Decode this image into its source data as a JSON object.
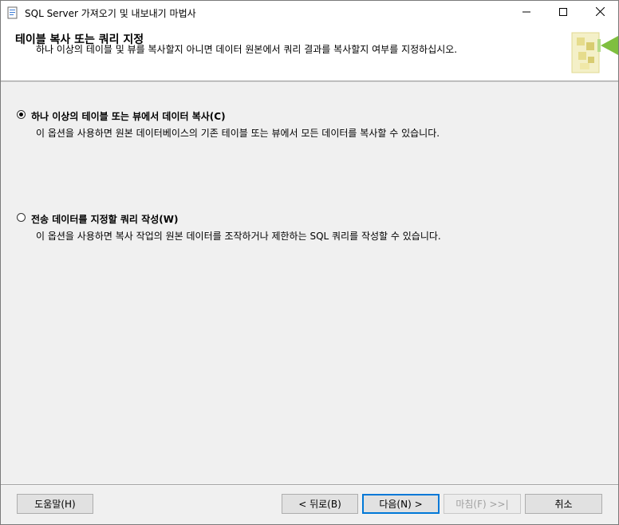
{
  "window": {
    "title": "SQL Server 가져오기 및 내보내기 마법사",
    "icons": [
      "app-icon",
      "minimize-icon",
      "maximize-icon",
      "close-icon"
    ]
  },
  "header": {
    "title": "테이블 복사 또는 쿼리 지정",
    "description": "하나 이상의 테이블 및 뷰를 복사할지 아니면 데이터 원본에서 쿼리 결과를 복사할지 여부를 지정하십시오.",
    "graphic": "wizard-graphic-icon"
  },
  "options": [
    {
      "label": "하나 이상의 테이블 또는 뷰에서 데이터 복사(C)",
      "description": "이 옵션을 사용하면 원본 데이터베이스의 기존 테이블 또는 뷰에서 모든 데이터를 복사할 수 있습니다.",
      "selected": true
    },
    {
      "label": "전송 데이터를 지정할 쿼리 작성(W)",
      "description": "이 옵션을 사용하면 복사 작업의 원본 데이터를 조작하거나 제한하는 SQL 쿼리를 작성할 수 있습니다.",
      "selected": false
    }
  ],
  "footer": {
    "help_label": "도움말(H)",
    "back_label": "< 뒤로(B)",
    "next_label": "다음(N) >",
    "finish_label": "마침(F) >>|",
    "cancel_label": "취소"
  },
  "colors": {
    "accent": "#0078d7",
    "disabled_text": "#a0a0a0",
    "banner_green": "#7fbf3f"
  }
}
